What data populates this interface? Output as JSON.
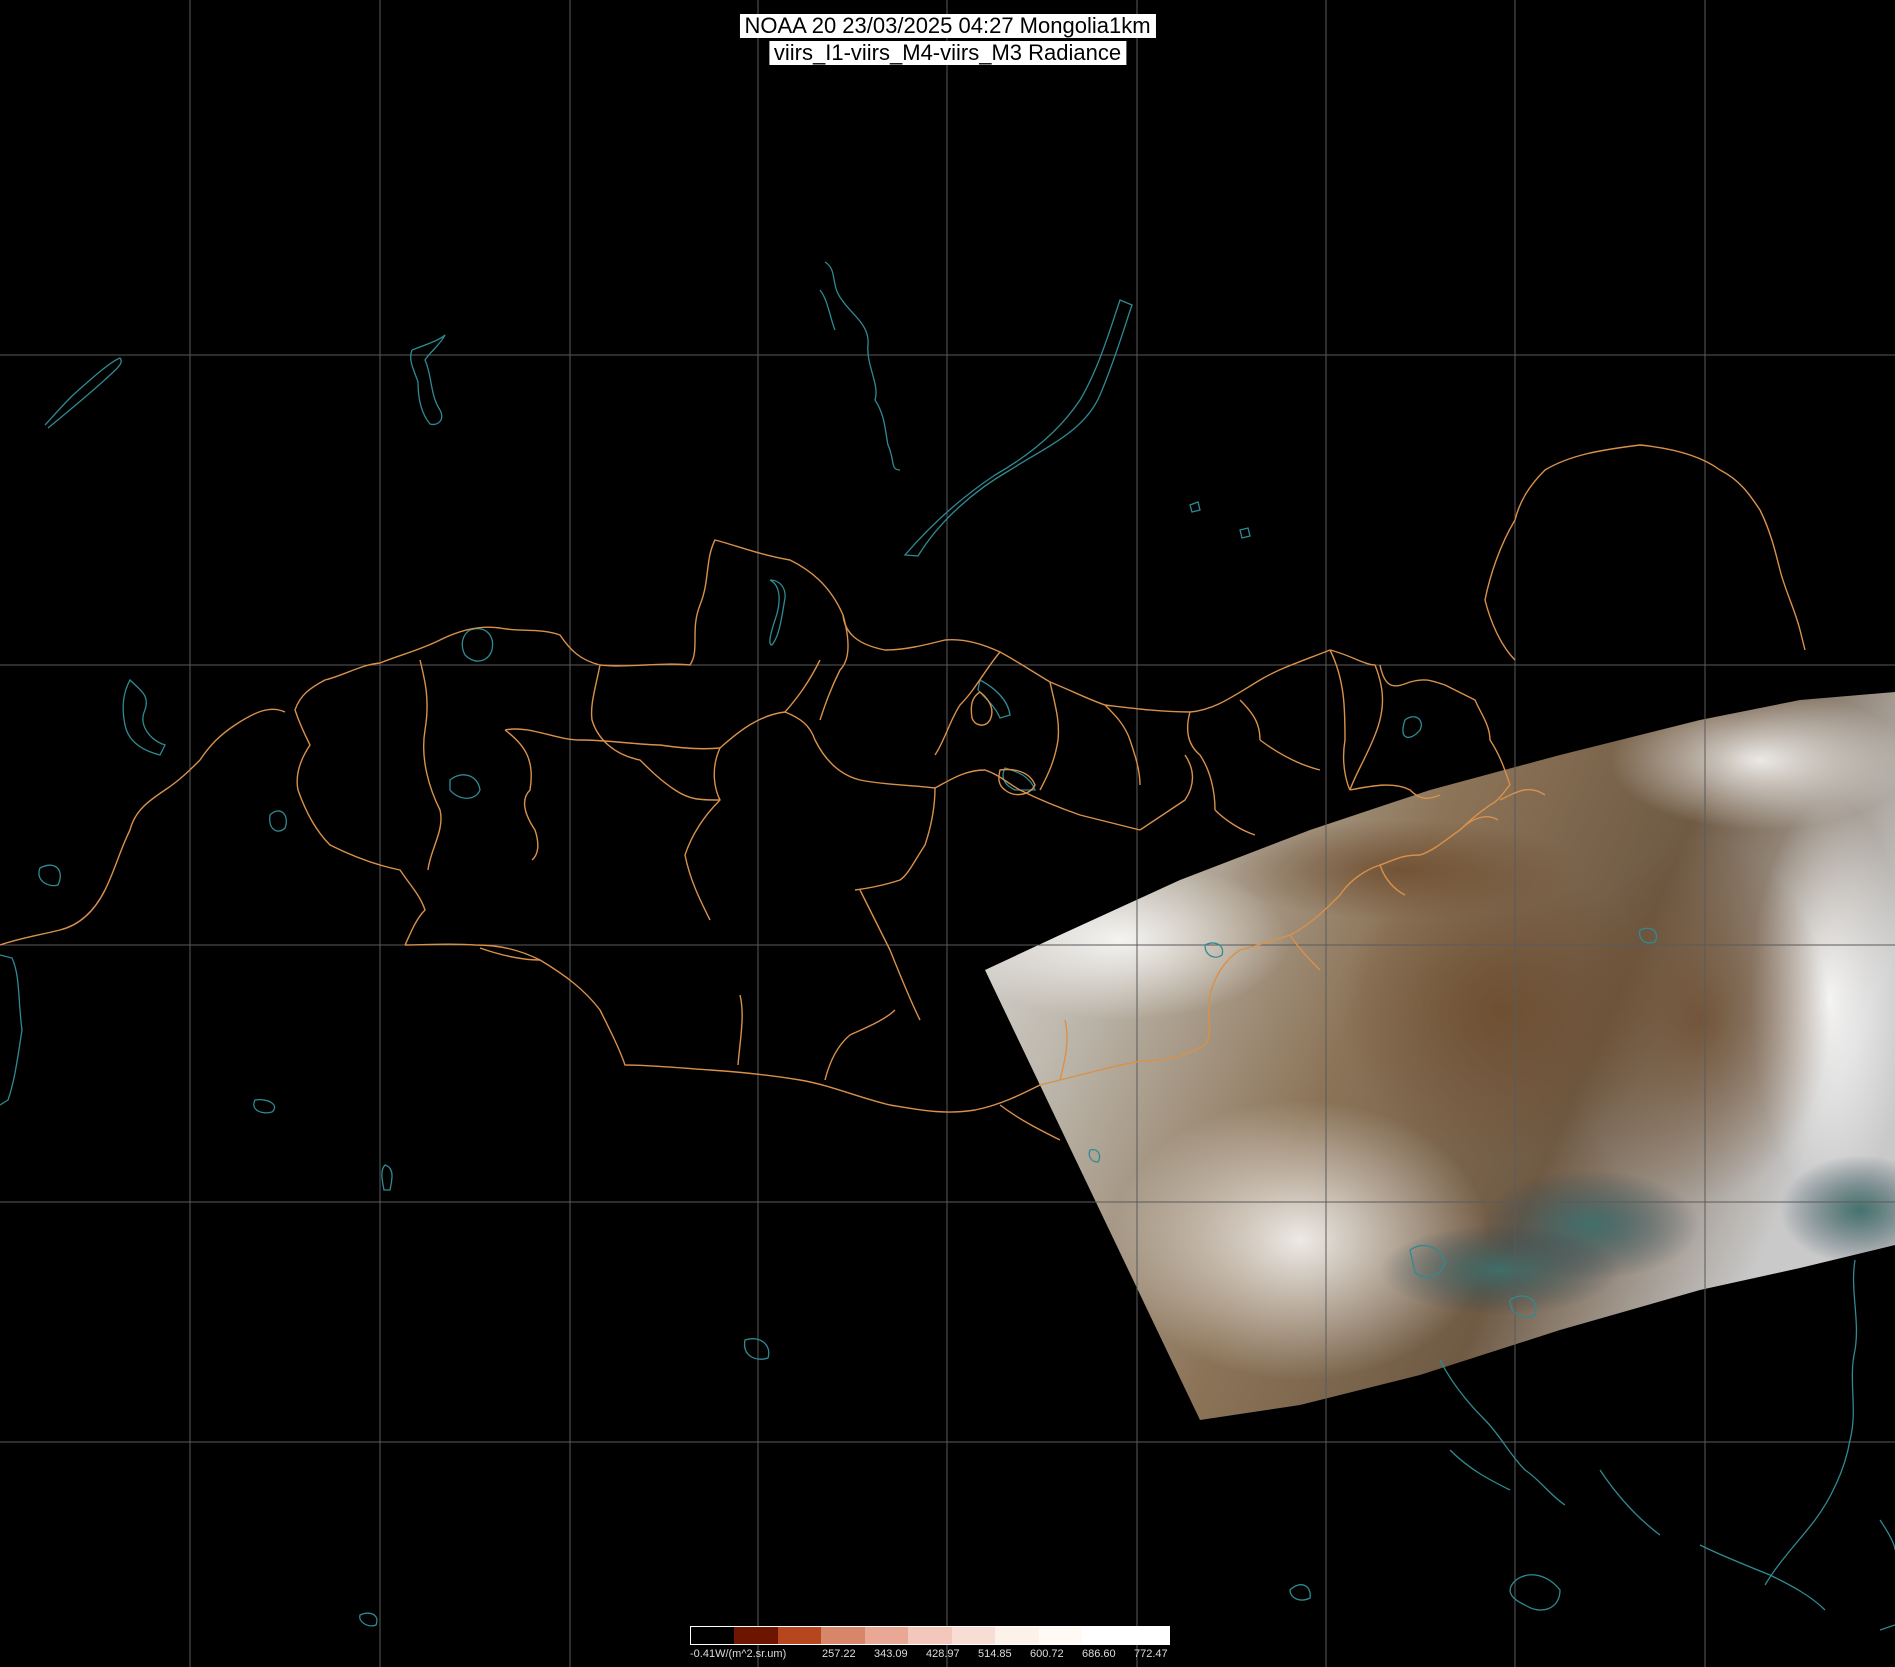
{
  "title": {
    "line1": "NOAA 20 23/03/2025 04:27 Mongolia1km",
    "line2": "viirs_I1-viirs_M4-viirs_M3 Radiance"
  },
  "colors": {
    "background": "#000000",
    "grid": "#5a5a5a",
    "coastline": "#2f8a93",
    "admin_border": "#d9914a"
  },
  "colorbar": {
    "swatches": [
      "#000000",
      "#6e1500",
      "#b5461e",
      "#d8866a",
      "#e9a896",
      "#f3c7bc",
      "#f8ddd4",
      "#fdf2ea",
      "#fffaf3",
      "#ffffff",
      "#ffffff"
    ],
    "labels": [
      "-0.41W/(m^2.sr.um)",
      "257.22",
      "343.09",
      "428.97",
      "514.85",
      "600.72",
      "686.60",
      "772.47"
    ]
  }
}
